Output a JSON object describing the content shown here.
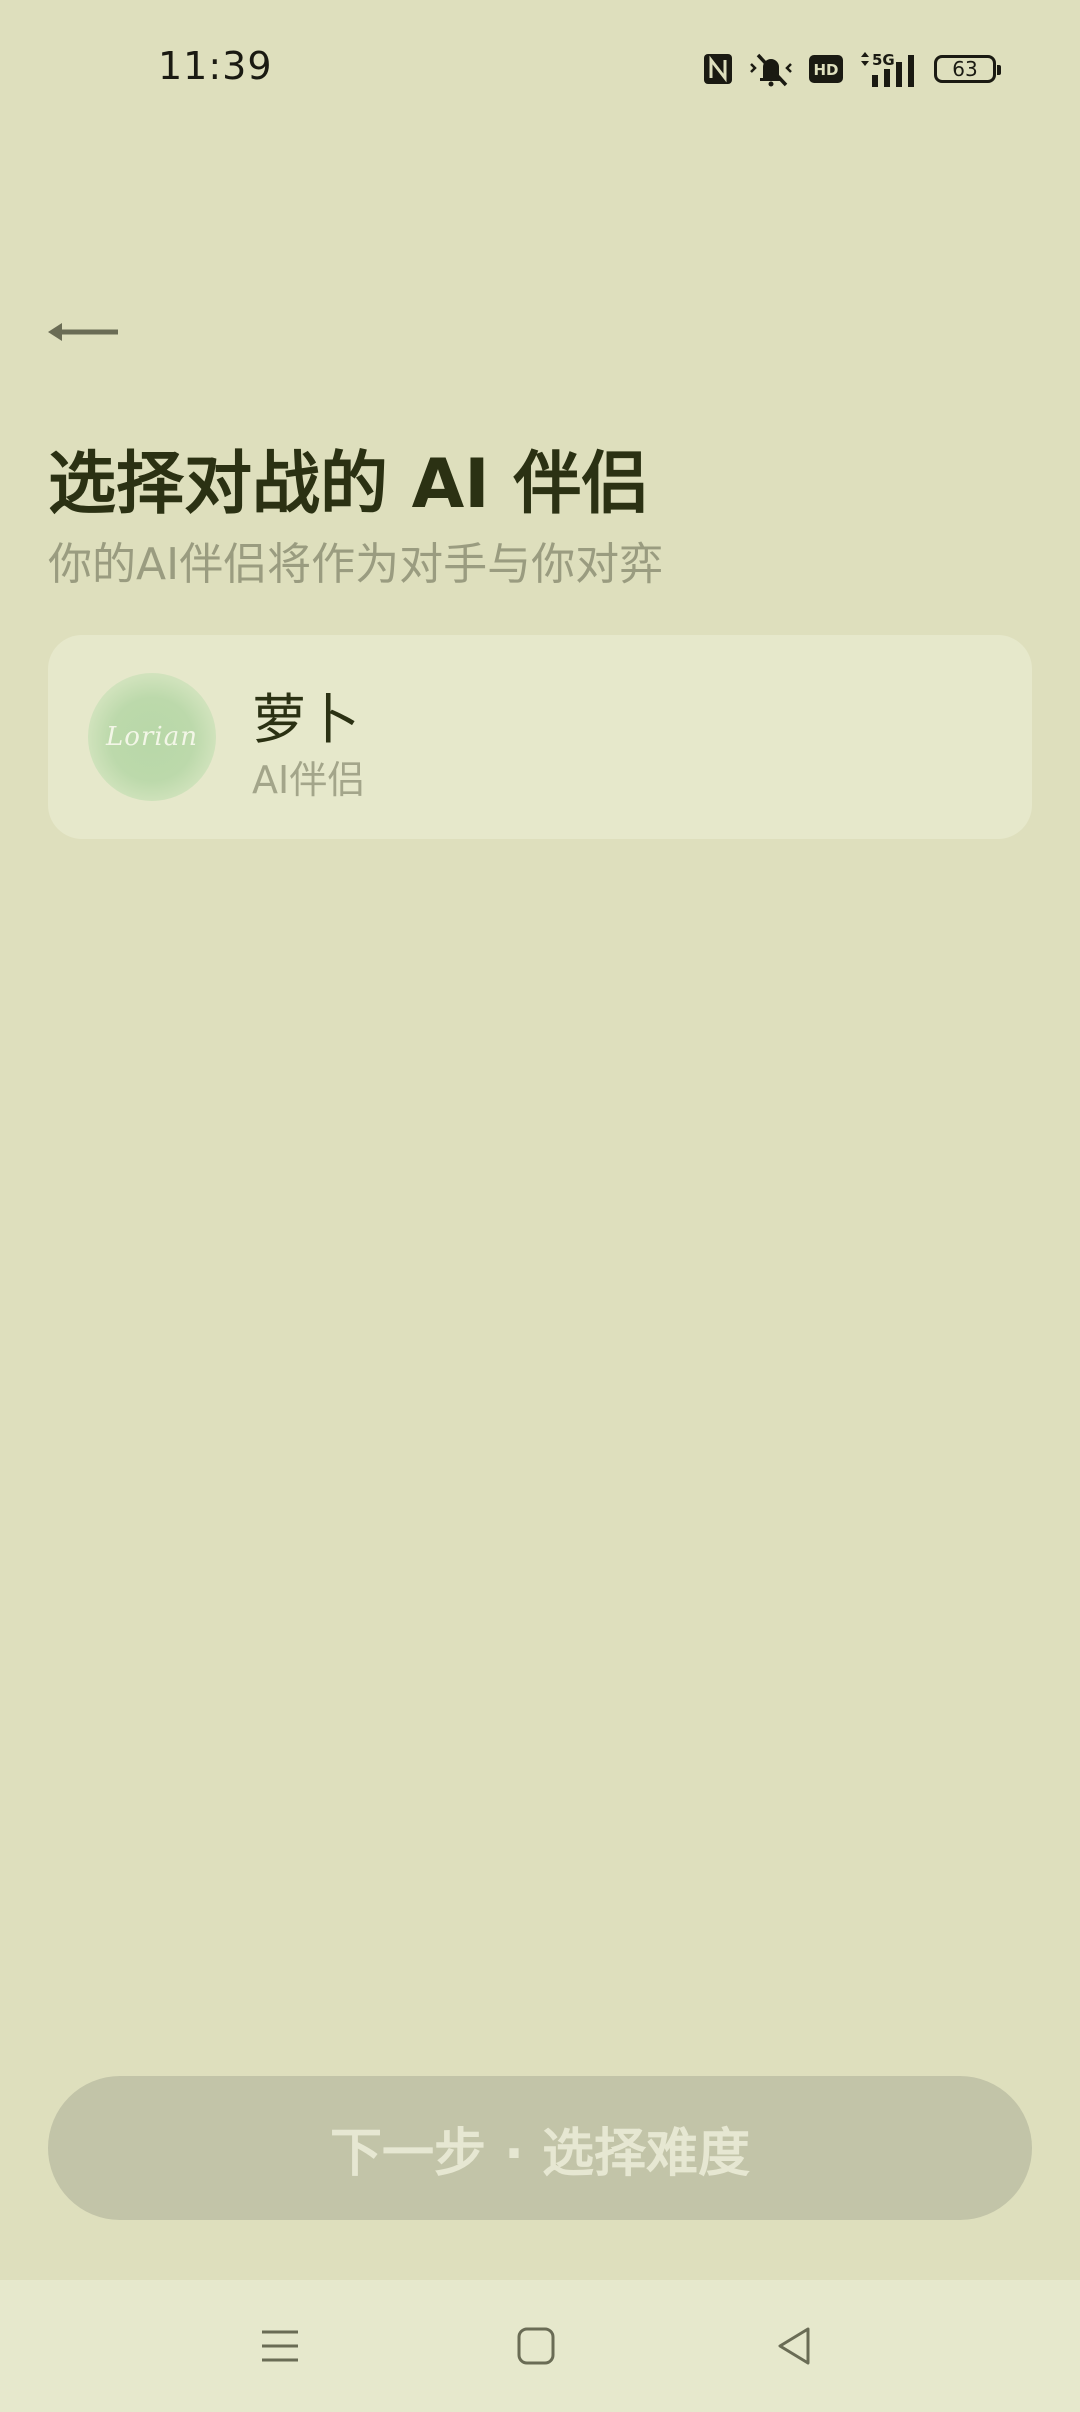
{
  "status_bar": {
    "time": "11:39",
    "icons": [
      "nfc-icon",
      "mute-icon",
      "hd-icon",
      "5g-signal-icon"
    ],
    "battery_level": "63"
  },
  "header": {
    "back_icon": "arrow-left-icon",
    "title": "选择对战的 AI 伴侣",
    "subtitle": "你的AI伴侣将作为对手与你对弈"
  },
  "companions": [
    {
      "name": "萝卜",
      "type": "AI伴侣",
      "avatar_text": "Lorian"
    }
  ],
  "footer": {
    "next_label": "下一步 · 选择难度"
  },
  "nav_bar": {
    "icons": [
      "menu-icon",
      "home-icon",
      "back-icon"
    ]
  },
  "colors": {
    "background": "#dedfbd",
    "card": "#e6e8cb",
    "title": "#2b3113",
    "subtitle": "#9a9c80",
    "button_disabled": "#c2c4a8",
    "button_text": "#e6e7d2"
  }
}
